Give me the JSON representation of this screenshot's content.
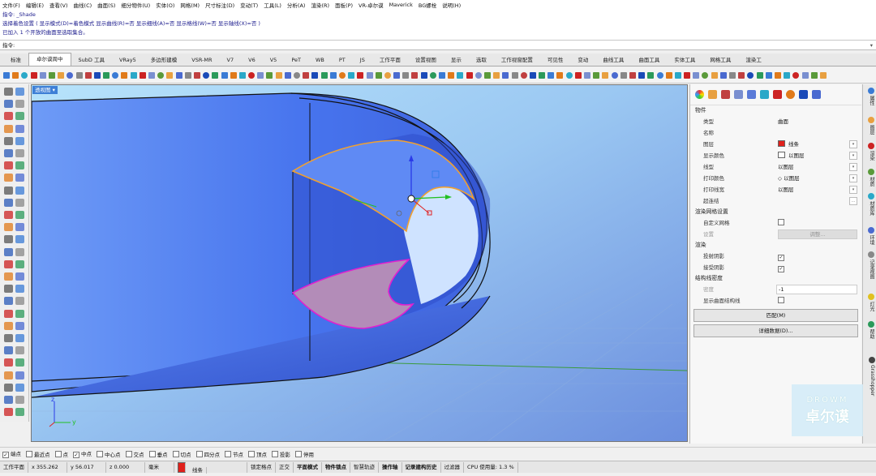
{
  "menu": [
    "文件(F)",
    "编辑(E)",
    "查看(V)",
    "曲线(C)",
    "曲面(S)",
    "细分物件(U)",
    "实体(O)",
    "网格(M)",
    "尺寸标注(D)",
    "变动(T)",
    "工具(L)",
    "分析(A)",
    "渲染(R)",
    "面板(P)",
    "VR-卓尔谟",
    "Maverick",
    "BG螺栓",
    "说明(H)"
  ],
  "history": {
    "line1": "指令: _Shade",
    "line2": "选择着色设置 ( 显示模式(D)=着色模式  显示曲线(R)=否  显示细线(A)=否  显示格线(W)=否  显示轴线(X)=否 )",
    "line3": "已加入 1 个开放的曲面至选取集合。"
  },
  "command": {
    "label": "指令:"
  },
  "tabs": [
    "标准",
    "卓尔谟周中",
    "SubD 工具",
    "VRay5",
    "多边形建模",
    "VSR-MR",
    "V7",
    "V6",
    "V5",
    "PeT",
    "WB",
    "PT",
    "JS",
    "工作平面",
    "设置视图",
    "显示",
    "选取",
    "工作视窗配置",
    "可见性",
    "变动",
    "曲线工具",
    "曲面工具",
    "实体工具",
    "网格工具",
    "渲染工"
  ],
  "viewport": {
    "title": "透视图"
  },
  "properties": {
    "section_object": "物件",
    "rows": [
      {
        "key": "类型",
        "value": "曲面"
      },
      {
        "key": "名称",
        "value": ""
      },
      {
        "key": "图层",
        "value": "线条"
      },
      {
        "key": "显示颜色",
        "value": "以图层"
      },
      {
        "key": "线型",
        "value": "以图层"
      },
      {
        "key": "打印颜色",
        "value": "以图层"
      },
      {
        "key": "打印线宽",
        "value": "以图层"
      },
      {
        "key": "超连结",
        "value": ""
      }
    ],
    "section_mesh": "渲染网格设置",
    "custom_mesh": "自定义网格",
    "settings": "设置",
    "adjust_button": "调整...",
    "section_render": "渲染",
    "cast_shadow": "投射阴影",
    "receive_shadow": "接受阴影",
    "section_iso": "结构线密度",
    "density_label": "密度",
    "density_value": "-1",
    "show_iso": "显示曲面结构线",
    "match_button": "匹配(M)",
    "details_button": "详细数据(D)..."
  },
  "side_tabs": [
    "属性",
    "图层",
    "渲染",
    "材质",
    "材质库",
    "环境",
    "记录视图",
    "灯光",
    "帮助",
    "Grasshopper"
  ],
  "watermark": {
    "brand": "DROWM",
    "name": "卓尔谟"
  },
  "osnap": [
    "端点",
    "最近点",
    "点",
    "中点",
    "中心点",
    "交点",
    "垂点",
    "切点",
    "四分点",
    "节点",
    "顶点",
    "投影",
    "停用"
  ],
  "status": {
    "cplane": "工作平面",
    "x": "x 355.262",
    "y": "y 56.017",
    "z": "z 0.000",
    "unit": "毫米",
    "layer": "线条",
    "grid_snap": "锁定格点",
    "ortho": "正交",
    "planar": "平面模式",
    "osnap": "物件锁点",
    "smarttrack": "智慧轨迹",
    "gumball": "操作轴",
    "history": "记录建构历史",
    "filter": "过滤器",
    "cpu": "CPU 使用量: 1.3 %"
  },
  "colors": {
    "accent_blue": "#3d7fd6",
    "layer_red": "#e0201b",
    "surface_orange": "#f0a030",
    "surface_magenta": "#e020d0",
    "body_blue": "#4a7ff0"
  }
}
